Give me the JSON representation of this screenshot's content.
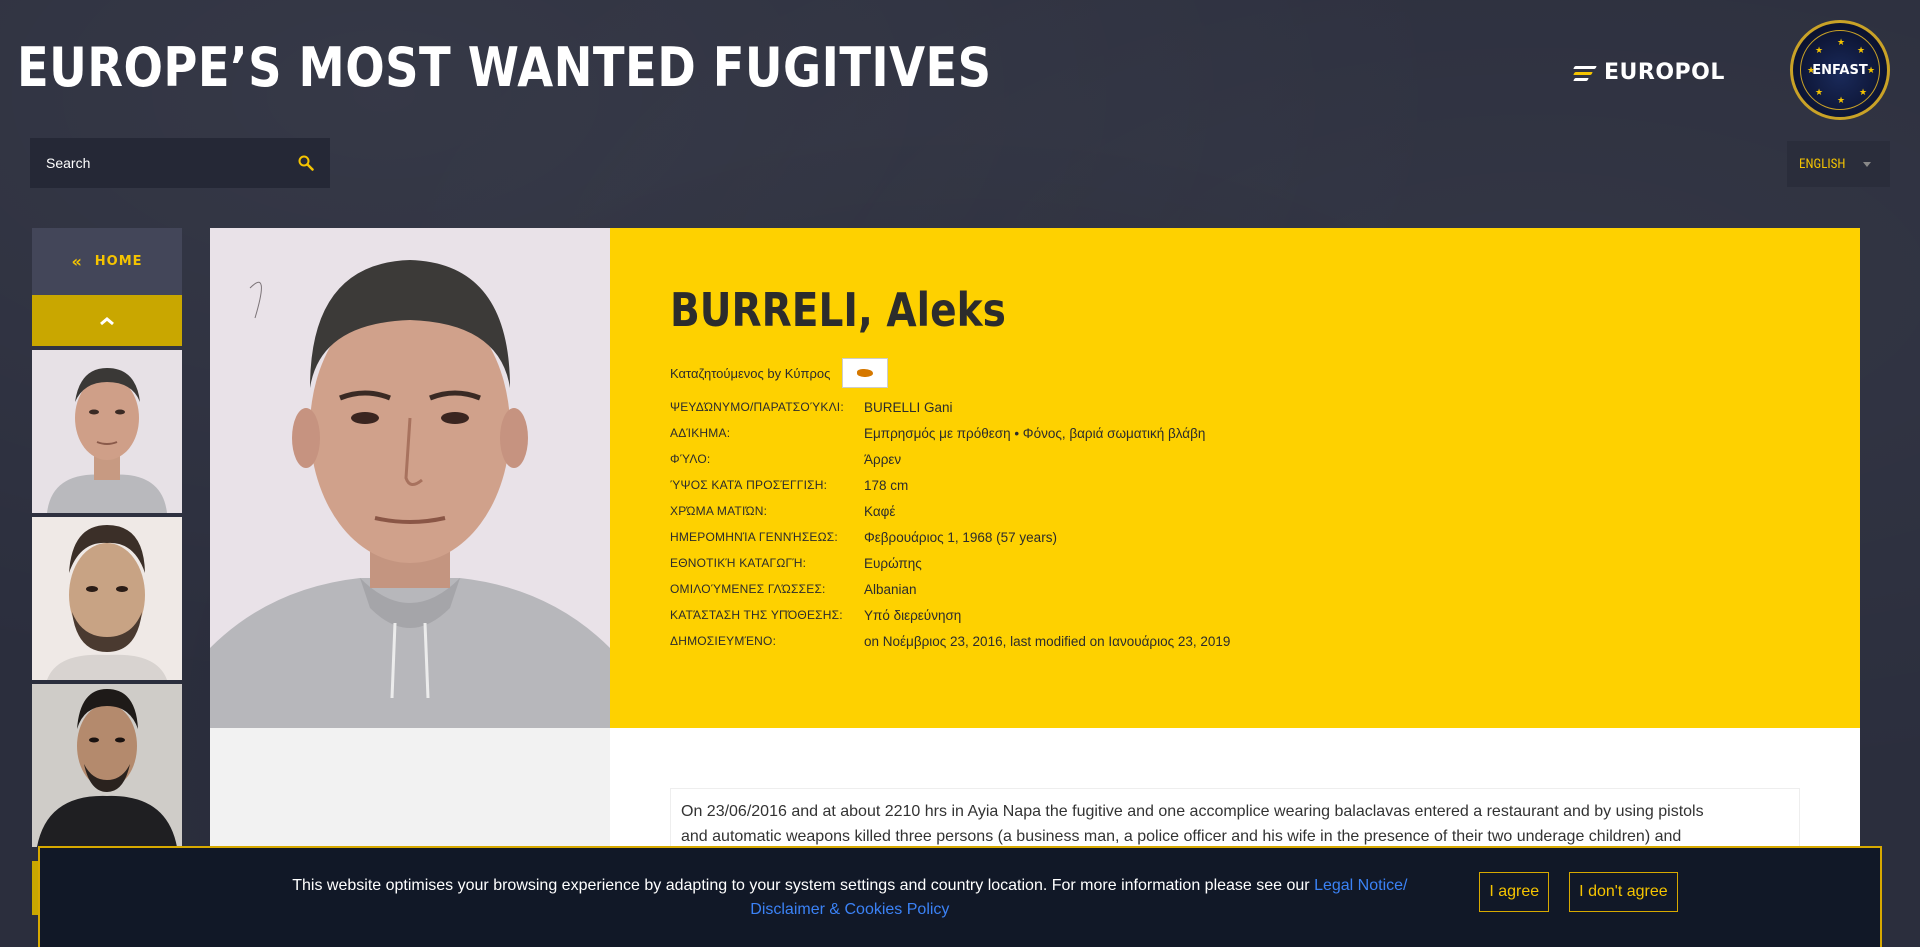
{
  "header": {
    "title": "EUROPE’S MOST WANTED FUGITIVES",
    "europol_logo_text": "EUROPOL",
    "enfast_logo_text": "ENFAST"
  },
  "search": {
    "placeholder": "Search"
  },
  "language": {
    "selected": "ENGLISH"
  },
  "sidebar": {
    "home_label": "HOME",
    "home_icon": "double-chevron-left-icon",
    "up_icon": "chevron-up-icon"
  },
  "profile": {
    "name": "BURRELI, Aleks",
    "wanted_by": "Καταζητούμενος by Κύπρος",
    "flag": "cyprus-flag",
    "details": [
      {
        "label": "Ψευδώνυμο/Παρατσούκλι:",
        "value": "BURELLI Gani"
      },
      {
        "label": "Αδίκημα:",
        "value": "Εμπρησμός με πρόθεση • Φόνος, βαριά σωματική βλάβη"
      },
      {
        "label": "Φύλο:",
        "value": "Άρρεν"
      },
      {
        "label": "Ύψος κατά προσέγγιση:",
        "value": "178 cm"
      },
      {
        "label": "Χρώμα ματιών:",
        "value": "Καφέ"
      },
      {
        "label": "Ημερομηνία γεννήσεως:",
        "value": "Φεβρουάριος 1, 1968 (57 years)"
      },
      {
        "label": "Εθνοτική καταγωγή:",
        "value": "Ευρώπης"
      },
      {
        "label": "Ομιλούμενες γλώσσες:",
        "value": "Albanian"
      },
      {
        "label": "Κατάσταση της υπόθεσης:",
        "value": "Υπό διερεύνηση"
      },
      {
        "label": "Δημοσιευμένο:",
        "value": "on Νοέμβριος 23, 2016, last modified on Ιανουάριος 23, 2019"
      }
    ],
    "description_line1": "On 23/06/2016 and at about 2210 hrs in Ayia Napa the fugitive and one accomplice wearing balaclavas entered a restaurant and by using pistols",
    "description_line2": "and automatic weapons killed three persons (a business man, a police officer and his wife in the presence of their two underage children) and"
  },
  "cookie": {
    "text": "This website optimises your browsing experience by adapting to your system settings and country location. For more information please see our",
    "link_part1": "Legal Notice/",
    "link_part2": "Disclaimer & Cookies Policy",
    "agree": "I agree",
    "disagree": "I don't agree"
  },
  "colors": {
    "accent_yellow": "#fed100",
    "dark_bg": "#2b2e3d",
    "link_blue": "#3b82f6"
  }
}
